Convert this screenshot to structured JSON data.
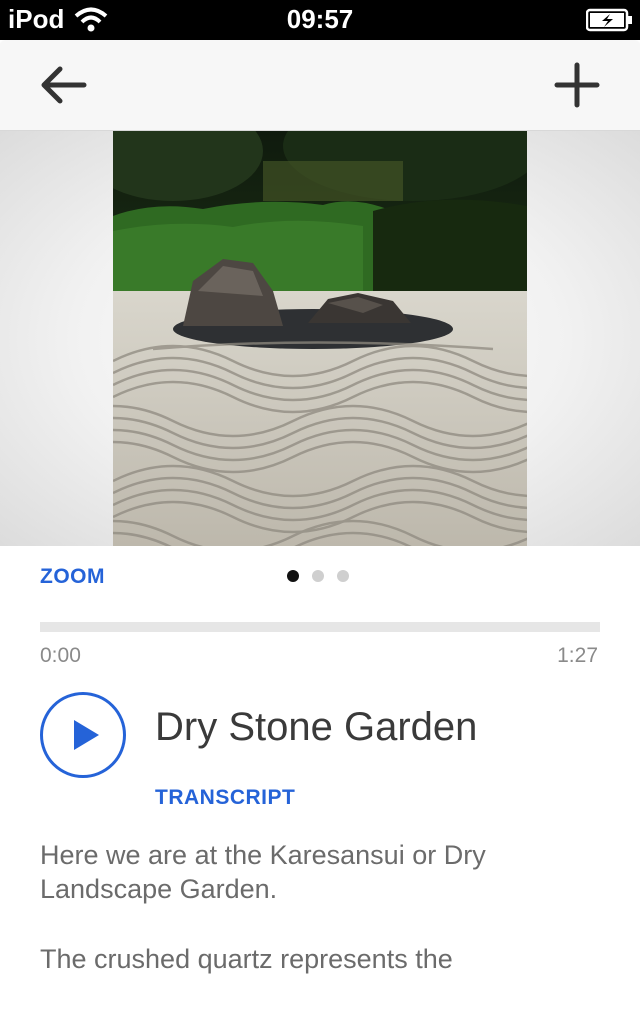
{
  "status_bar": {
    "carrier": "iPod",
    "time": "09:57",
    "icons": [
      "wifi-icon",
      "battery-charging-icon"
    ]
  },
  "nav": {
    "back_icon": "arrow-left-icon",
    "add_icon": "plus-icon"
  },
  "media": {
    "image_subject": "zen dry garden with rocks and raked gravel",
    "zoom_label": "ZOOM",
    "page_count": 3,
    "active_page": 1
  },
  "player": {
    "current_time": "0:00",
    "total_time": "1:27",
    "progress": 0,
    "play_icon": "play-icon"
  },
  "stop": {
    "title": "Dry Stone Garden",
    "transcript_label": "TRANSCRIPT",
    "paragraphs": [
      "Here we are at the Karesansui or Dry Landscape Garden.",
      "The crushed quartz represents the"
    ]
  },
  "colors": {
    "accent": "#2563d8",
    "text": "#3a3a3a",
    "muted": "#8a8a8a"
  }
}
